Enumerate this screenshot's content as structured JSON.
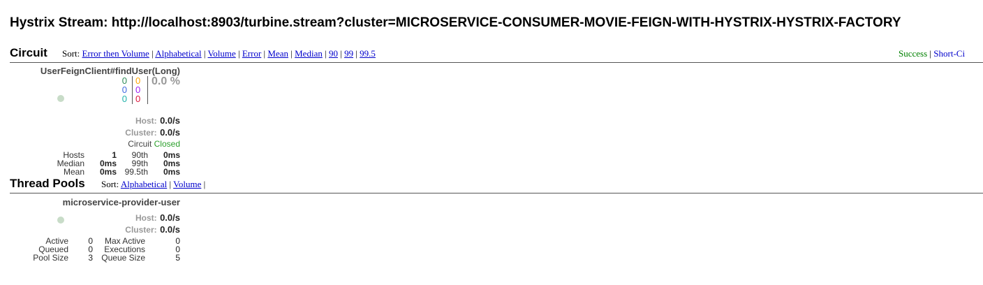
{
  "page": {
    "title": "Hystrix Stream: http://localhost:8903/turbine.stream?cluster=MICROSERVICE-CONSUMER-MOVIE-FEIGN-WITH-HYSTRIX-HYSTRIX-FACTORY"
  },
  "circuit_section": {
    "title": "Circuit",
    "sort_label": "Sort:",
    "sort_links": [
      "Error then Volume",
      "Alphabetical",
      "Volume",
      "Error",
      "Mean",
      "Median",
      "90",
      "99",
      "99.5"
    ],
    "legend_success": "Success",
    "legend_separator": "|",
    "legend_short": "Short-Ci"
  },
  "circuit": {
    "name": "UserFeignClient#findUser(Long)",
    "counts_left": [
      "0",
      "0",
      "0"
    ],
    "counts_right": [
      "0",
      "0",
      "0"
    ],
    "error_pct": "0.0 %",
    "host_label": "Host:",
    "host_value": "0.0/s",
    "cluster_label": "Cluster:",
    "cluster_value": "0.0/s",
    "circuit_label": "Circuit",
    "circuit_status": "Closed",
    "stats": {
      "hosts_label": "Hosts",
      "hosts_value": "1",
      "median_label": "Median",
      "median_value": "0ms",
      "mean_label": "Mean",
      "mean_value": "0ms",
      "p90_label": "90th",
      "p90_value": "0ms",
      "p99_label": "99th",
      "p99_value": "0ms",
      "p995_label": "99.5th",
      "p995_value": "0ms"
    }
  },
  "threadpool_section": {
    "title": "Thread Pools",
    "sort_label": "Sort:",
    "sort_links": [
      "Alphabetical",
      "Volume"
    ]
  },
  "threadpool": {
    "name": "microservice-provider-user",
    "host_label": "Host:",
    "host_value": "0.0/s",
    "cluster_label": "Cluster:",
    "cluster_value": "0.0/s",
    "stats": {
      "active_label": "Active",
      "active_value": "0",
      "queued_label": "Queued",
      "queued_value": "0",
      "poolsize_label": "Pool Size",
      "poolsize_value": "3",
      "maxactive_label": "Max Active",
      "maxactive_value": "0",
      "executions_label": "Executions",
      "executions_value": "0",
      "queuesize_label": "Queue Size",
      "queuesize_value": "5"
    }
  },
  "colors": {
    "link": "#0000cc",
    "success": "#008000",
    "count_green": "#2e8b57",
    "count_blue": "#4169e1",
    "count_teal": "#20b2aa",
    "count_orange": "#ffa500",
    "count_purple": "#a020f0",
    "count_red": "#dc143c",
    "closed": "#2ca02c"
  }
}
